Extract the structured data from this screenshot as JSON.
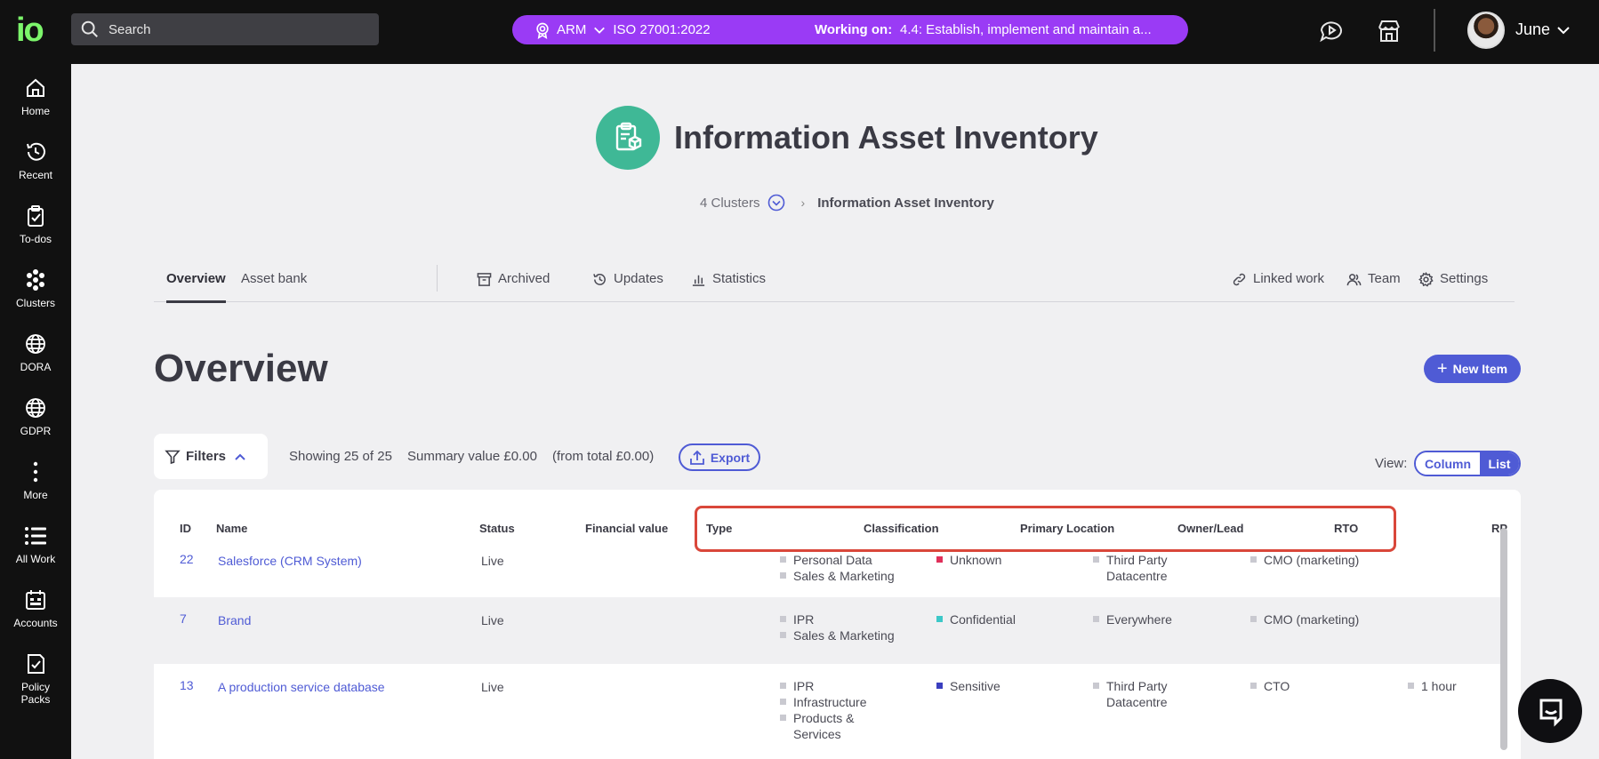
{
  "topbar": {
    "logo": "io",
    "search_placeholder": "Search",
    "framework": "ARM",
    "standard": "ISO 27001:2022",
    "working_label": "Working on:",
    "working_task": "4.4: Establish, implement and maintain a...",
    "username": "June",
    "pill_color": "#9a3bf5",
    "icons": [
      "chat-play-icon",
      "store-icon"
    ]
  },
  "sidebar": {
    "items": [
      {
        "label": "Home",
        "icon": "home-icon"
      },
      {
        "label": "Recent",
        "icon": "history-icon"
      },
      {
        "label": "To-dos",
        "icon": "clipboard-check-icon"
      },
      {
        "label": "Clusters",
        "icon": "clusters-icon"
      },
      {
        "label": "DORA",
        "icon": "globe-icon"
      },
      {
        "label": "GDPR",
        "icon": "globe-icon"
      },
      {
        "label": "More",
        "icon": "more-vertical-icon"
      },
      {
        "label": "All Work",
        "icon": "list-icon"
      },
      {
        "label": "Accounts",
        "icon": "calendar-icon"
      },
      {
        "label": "Policy Packs",
        "icon": "document-check-icon"
      }
    ]
  },
  "page": {
    "title": "Information Asset Inventory",
    "icon_color": "#3fb896",
    "breadcrumb": {
      "parent": "4 Clusters",
      "current": "Information Asset Inventory"
    }
  },
  "tabs": {
    "left": [
      "Overview",
      "Asset bank"
    ],
    "middle": [
      "Archived",
      "Updates",
      "Statistics"
    ],
    "right": [
      "Linked work",
      "Team",
      "Settings"
    ],
    "active": "Overview"
  },
  "overview": {
    "heading": "Overview",
    "new_item": "New Item",
    "filters": "Filters",
    "showing": "Showing 25 of 25",
    "summary": "Summary value £0.00",
    "from_total": "(from total £0.00)",
    "export": "Export",
    "view_label": "View:",
    "view_column": "Column",
    "view_list": "List",
    "accent": "#4f5bd5"
  },
  "table": {
    "columns": [
      "ID",
      "Name",
      "Status",
      "Financial value",
      "Type",
      "Classification",
      "Primary Location",
      "Owner/Lead",
      "RTO",
      "RP"
    ],
    "rows": [
      {
        "id": "22",
        "name": "Salesforce (CRM System)",
        "status": "Live",
        "financial": "",
        "type": [
          "Personal Data",
          "Sales & Marketing"
        ],
        "classification": {
          "label": "Unknown",
          "color": "#e0305a"
        },
        "location": [
          "Third Party",
          "Datacentre"
        ],
        "owner": "CMO (marketing)",
        "rto": ""
      },
      {
        "id": "7",
        "name": "Brand",
        "status": "Live",
        "financial": "",
        "type": [
          "IPR",
          "Sales & Marketing"
        ],
        "classification": {
          "label": "Confidential",
          "color": "#3cc8c8"
        },
        "location": [
          "Everywhere"
        ],
        "owner": "CMO (marketing)",
        "rto": ""
      },
      {
        "id": "13",
        "name": "A production service database",
        "status": "Live",
        "financial": "",
        "type": [
          "IPR",
          "Infrastructure",
          "Products &",
          "Services"
        ],
        "classification": {
          "label": "Sensitive",
          "color": "#3b3fbf"
        },
        "location": [
          "Third Party",
          "Datacentre"
        ],
        "owner": "CTO",
        "rto": "1 hour"
      }
    ]
  }
}
